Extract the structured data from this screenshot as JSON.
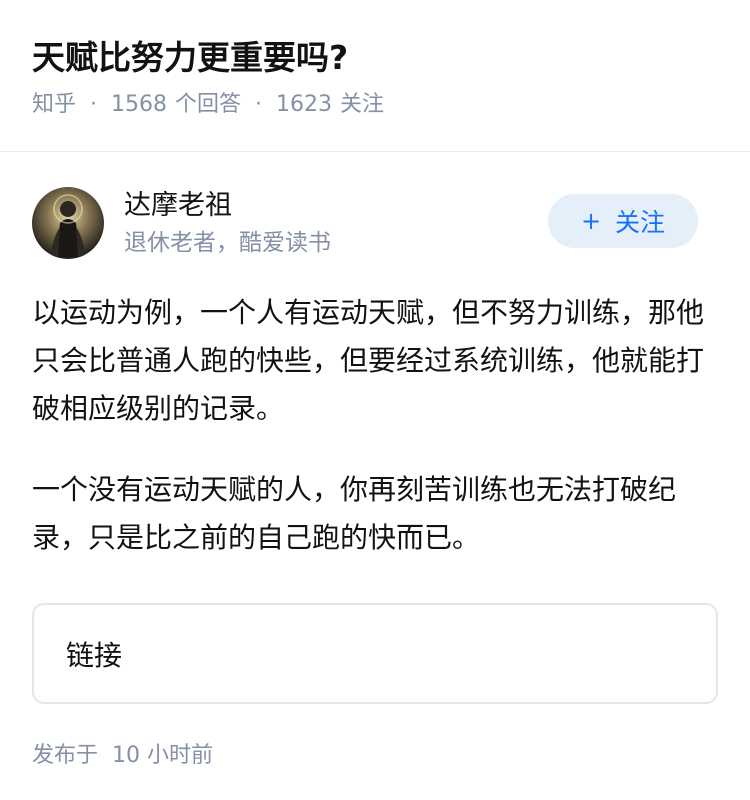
{
  "question": {
    "title": "天赋比努力更重要吗?",
    "source": "知乎",
    "separator": "·",
    "answers_count": "1568",
    "answers_label": "个回答",
    "followers_count": "1623",
    "followers_label": "关注"
  },
  "answer": {
    "author": {
      "name": "达摩老祖",
      "bio": "退休老者，酷爱读书",
      "avatar_icon": "robed-figure-avatar"
    },
    "follow_button": {
      "plus": "+",
      "label": "关注"
    },
    "paragraphs": [
      "以运动为例，一个人有运动天赋，但不努力训练，那他只会比普通人跑的快些，但要经过系统训练，他就能打破相应级别的记录。",
      "一个没有运动天赋的人，你再刻苦训练也无法打破纪录，只是比之前的自己跑的快而已。"
    ],
    "link_card": {
      "label": "链接"
    },
    "publish": {
      "label": "发布于",
      "time": "10 小时前"
    }
  },
  "colors": {
    "text": "#121212",
    "muted": "#8590a6",
    "accent": "#1772f6",
    "follow_bg": "#e5eff9"
  }
}
